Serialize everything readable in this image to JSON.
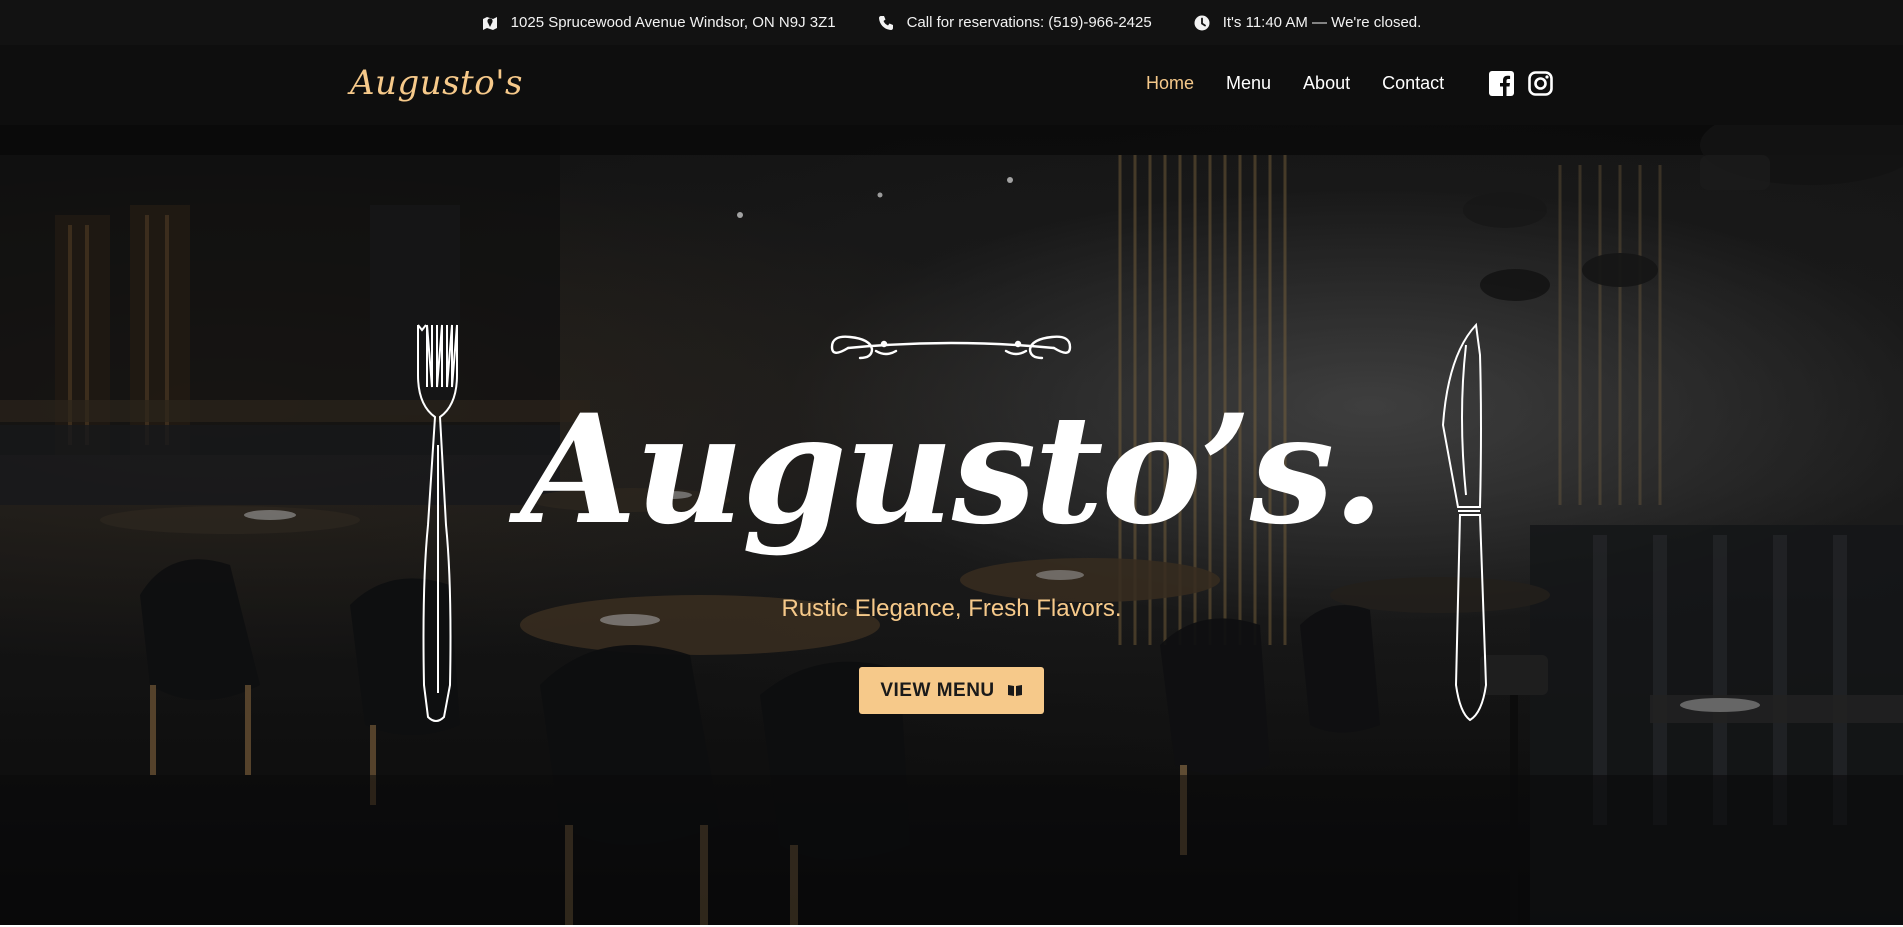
{
  "topbar": {
    "address": "1025 Sprucewood Avenue Windsor, ON N9J 3Z1",
    "phone": "Call for reservations: (519)-966-2425",
    "hours": "It's 11:40 AM — We're closed."
  },
  "nav": {
    "logo": "Augusto's",
    "links": [
      "Home",
      "Menu",
      "About",
      "Contact"
    ],
    "active": "Home"
  },
  "hero": {
    "title": "Augusto’s.",
    "tagline": "Rustic Elegance, Fresh Flavors.",
    "button_label": "VIEW MENU"
  },
  "colors": {
    "accent": "#f6c98a",
    "topbar_bg": "#121212",
    "navbar_bg": "#0e0e0e",
    "text": "#ffffff"
  },
  "icons": {
    "address": "map-marker-icon",
    "phone": "phone-icon",
    "hours": "clock-icon",
    "facebook": "facebook-icon",
    "instagram": "instagram-icon",
    "button": "book-icon"
  }
}
